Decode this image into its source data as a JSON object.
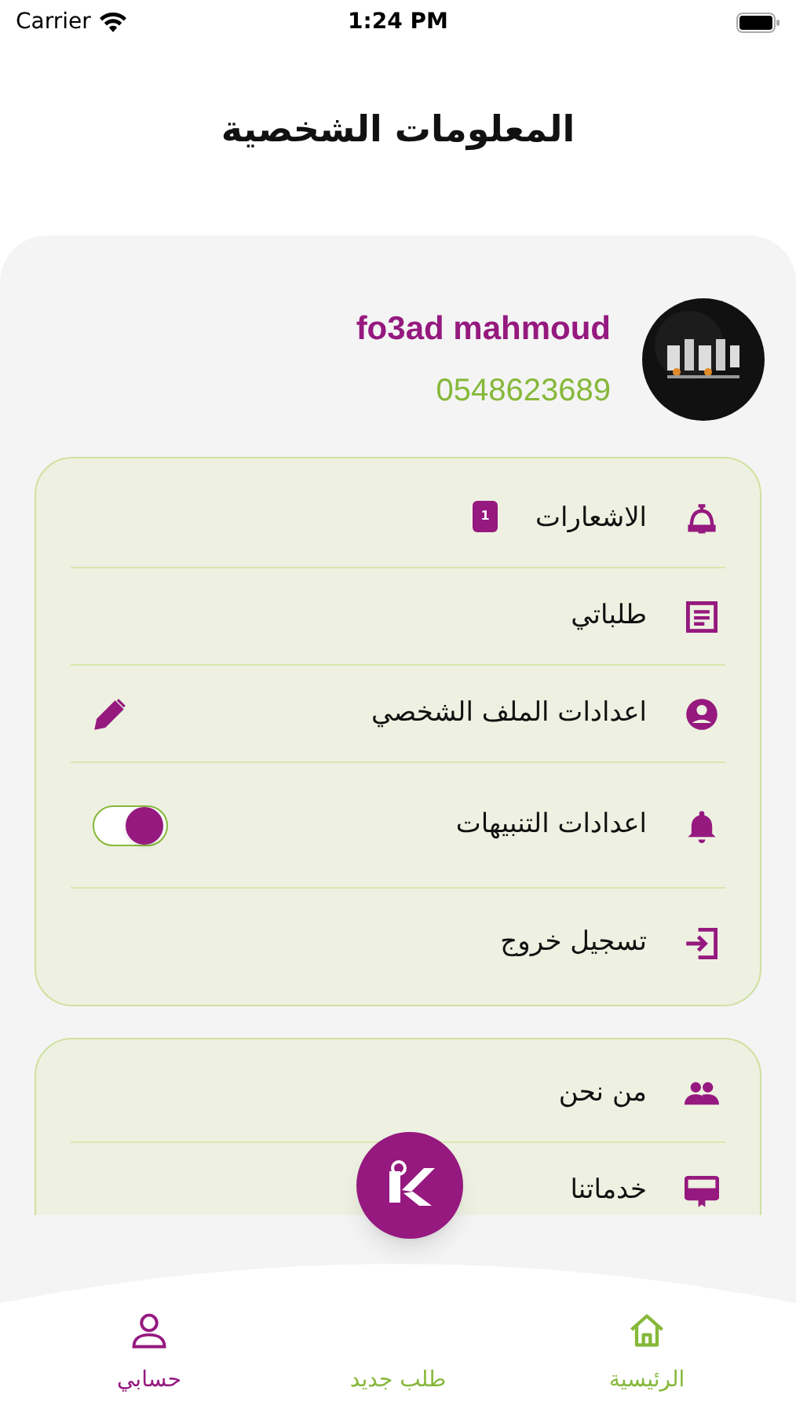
{
  "status_bar": {
    "carrier": "Carrier",
    "time": "1:24 PM"
  },
  "title": "المعلومات الشخصية",
  "profile": {
    "name": "fo3ad mahmoud",
    "phone": "0548623689"
  },
  "menu": [
    {
      "label": "الاشعارات",
      "kind": "badge",
      "badge": "1"
    },
    {
      "label": "طلباتي",
      "kind": "plain"
    },
    {
      "label": "اعدادات الملف الشخصي",
      "kind": "edit"
    },
    {
      "label": "اعدادات التنبيهات",
      "kind": "toggle",
      "on": true
    },
    {
      "label": "تسجيل خروج",
      "kind": "plain"
    }
  ],
  "menu_2": [
    {
      "label": "من نحن"
    },
    {
      "label": "خدماتنا"
    }
  ],
  "tabs": [
    {
      "label": "الرئيسية",
      "selected": false
    },
    {
      "label": "طلب جديد",
      "selected": false
    },
    {
      "label": "حسابي",
      "selected": true
    }
  ]
}
